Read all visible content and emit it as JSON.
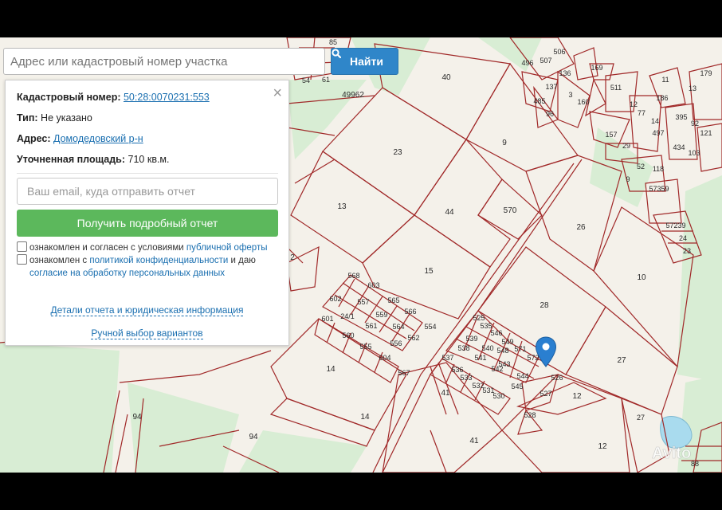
{
  "search": {
    "placeholder": "Адрес или кадастровый номер участка",
    "button_label": "Найти"
  },
  "panel": {
    "cadastral_label": "Кадастровый номер:",
    "cadastral_value": "50:28:0070231:553",
    "type_label": "Тип:",
    "type_value": "Не указано",
    "address_label": "Адрес:",
    "address_value": "Домодедовский р-н",
    "area_label": "Уточненная площадь:",
    "area_value": "710 кв.м.",
    "email_placeholder": "Ваш email, куда отправить отчет",
    "get_report_label": "Получить подробный отчет",
    "consent1_text": "ознакомлен и согласен с условиями",
    "consent1_link": "публичной оферты",
    "consent2_text": "ознакомлен с",
    "consent2_link": "политикой конфиденциальности",
    "consent2_mid": "и даю",
    "consent2_link2": "согласие на обработку персональных данных",
    "details_link": "Детали отчета и юридическая информация",
    "manual_link": "Ручной выбор вариантов",
    "close_symbol": "×"
  },
  "map": {
    "parcel_labels": [
      "40",
      "49962",
      "23",
      "9",
      "13",
      "44",
      "570",
      "26",
      "15",
      "2",
      "28",
      "10",
      "14",
      "27",
      "41",
      "12",
      "94",
      "568",
      "603",
      "565",
      "566",
      "554",
      "602",
      "557",
      "559",
      "564",
      "562",
      "24/1",
      "561",
      "556",
      "601",
      "560",
      "555",
      "604",
      "567",
      "525",
      "535",
      "546",
      "549",
      "539",
      "540",
      "548",
      "571",
      "538",
      "541",
      "542",
      "544",
      "537",
      "536",
      "533",
      "532",
      "531",
      "530",
      "543",
      "545",
      "527",
      "526",
      "528",
      "572",
      "485",
      "496",
      "507",
      "506",
      "137",
      "136",
      "160",
      "169",
      "96",
      "511",
      "77",
      "14",
      "186",
      "11",
      "179",
      "395",
      "92",
      "121",
      "57359",
      "57239",
      "24",
      "23",
      "157",
      "29",
      "118",
      "434",
      "103",
      "88",
      "497",
      "52",
      "9",
      "3",
      "12",
      "85",
      "61",
      "54",
      "57",
      "13"
    ],
    "watermark": "Avito",
    "line_color": "#a02828",
    "forest_color": "#d6ecd2",
    "water_color": "#a9dbee",
    "pin_color": "#2a7fd0"
  },
  "icons": {
    "search_icon": "search-icon",
    "pin_icon": "map-pin-icon"
  }
}
